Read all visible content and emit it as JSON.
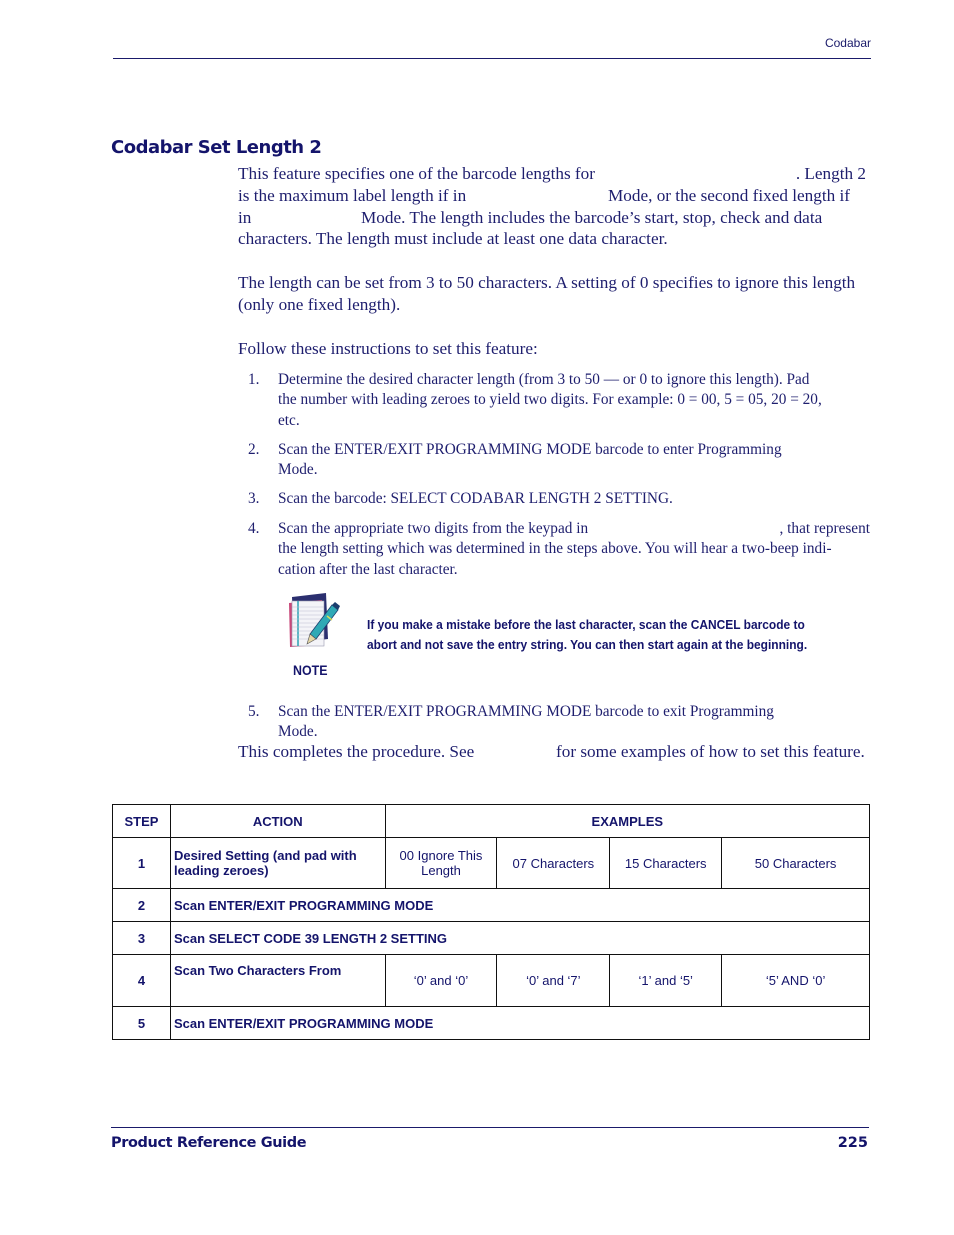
{
  "header": {
    "section_label": "Codabar"
  },
  "section": {
    "title": "Codabar Set Length 2"
  },
  "paragraphs": {
    "intro_line1_a": "This feature specifies one of the barcode lengths for",
    "intro_line1_b": ". Length 2",
    "intro_line2_a": "is the maximum label length if in",
    "intro_line2_b": "Mode, or the second fixed length if",
    "intro_line3_a": "in",
    "intro_line3_b": "Mode. The length includes the barcode’s start, stop, check and data",
    "intro_line4": "characters.  The length must include at least one data character.",
    "range_line1": "The length can be set from 3 to 50 characters. A setting of 0 specifies to ignore this length",
    "range_line2": "(only one fixed length).",
    "follow": "Follow these instructions to set this feature:",
    "complete_a": "This completes the procedure. See",
    "complete_b": "for some examples of how to set this feature."
  },
  "steps": [
    {
      "num": "1.",
      "lines": [
        "Determine the desired character length (from 3 to 50 — or 0 to ignore this length). Pad",
        "the number with leading zeroes to yield two digits. For example: 0 = 00, 5 = 05, 20 = 20,",
        "etc."
      ]
    },
    {
      "num": "2.",
      "lines": [
        "Scan the ENTER/EXIT PROGRAMMING MODE barcode to enter Programming",
        "Mode."
      ]
    },
    {
      "num": "3.",
      "lines": [
        "Scan the barcode: SELECT CODABAR LENGTH 2 SETTING."
      ]
    },
    {
      "num": "4.",
      "lines_a": "Scan the appropriate two digits from the keypad in",
      "lines_b": ", that represent",
      "lines": [
        "the length setting which was determined in the steps above. You will hear a two-beep indi-",
        "cation after the last character."
      ]
    },
    {
      "num": "5.",
      "lines": [
        "Scan the ENTER/EXIT PROGRAMMING MODE barcode to exit Programming",
        "Mode."
      ]
    }
  ],
  "note": {
    "icon": "notepad-pen-icon",
    "text_line1": "If you make a mistake before the last character, scan the CANCEL barcode to",
    "text_line2": "abort and not save the entry string. You can then start again at the beginning.",
    "label": "NOTE"
  },
  "table": {
    "headers": {
      "step": "STEP",
      "action": "ACTION",
      "examples": "EXAMPLES"
    },
    "rows": [
      {
        "step": "1",
        "action": "Desired Setting (and pad with leading zeroes)",
        "examples": [
          "00 Ignore This Length",
          "07 Characters",
          "15 Characters",
          "50 Characters"
        ]
      },
      {
        "step": "2",
        "action": "Scan ENTER/EXIT PROGRAMMING MODE"
      },
      {
        "step": "3",
        "action": "Scan SELECT CODE 39 LENGTH 2 SETTING"
      },
      {
        "step": "4",
        "action": "Scan Two Characters From",
        "examples": [
          "‘0’ and ‘0’",
          "‘0’ and ‘7’",
          "‘1’ and ‘5’",
          "‘5’ AND ‘0’"
        ]
      },
      {
        "step": "5",
        "action": "Scan ENTER/EXIT PROGRAMMING MODE"
      }
    ]
  },
  "footer": {
    "title": "Product Reference Guide",
    "page_number": "225"
  },
  "colors": {
    "text": "#1e1e6e",
    "heading": "#14146b",
    "rule": "#1a1a6a"
  }
}
